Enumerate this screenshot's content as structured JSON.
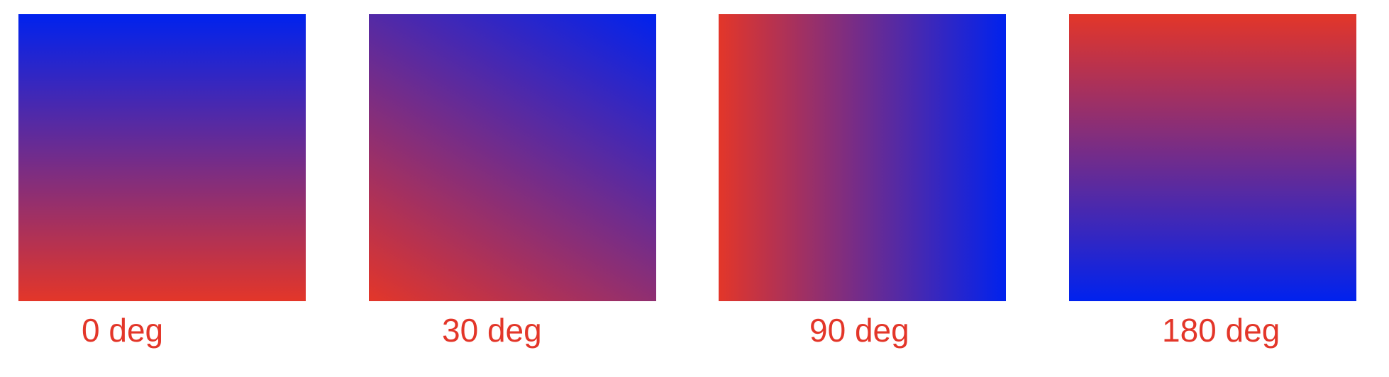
{
  "colors": {
    "red": "#e33629",
    "blue": "#0022ee",
    "caption": "#e33629"
  },
  "swatches": [
    {
      "angle": 0,
      "label": "0 deg"
    },
    {
      "angle": 30,
      "label": "30 deg"
    },
    {
      "angle": 90,
      "label": "90 deg"
    },
    {
      "angle": 180,
      "label": "180 deg"
    }
  ]
}
